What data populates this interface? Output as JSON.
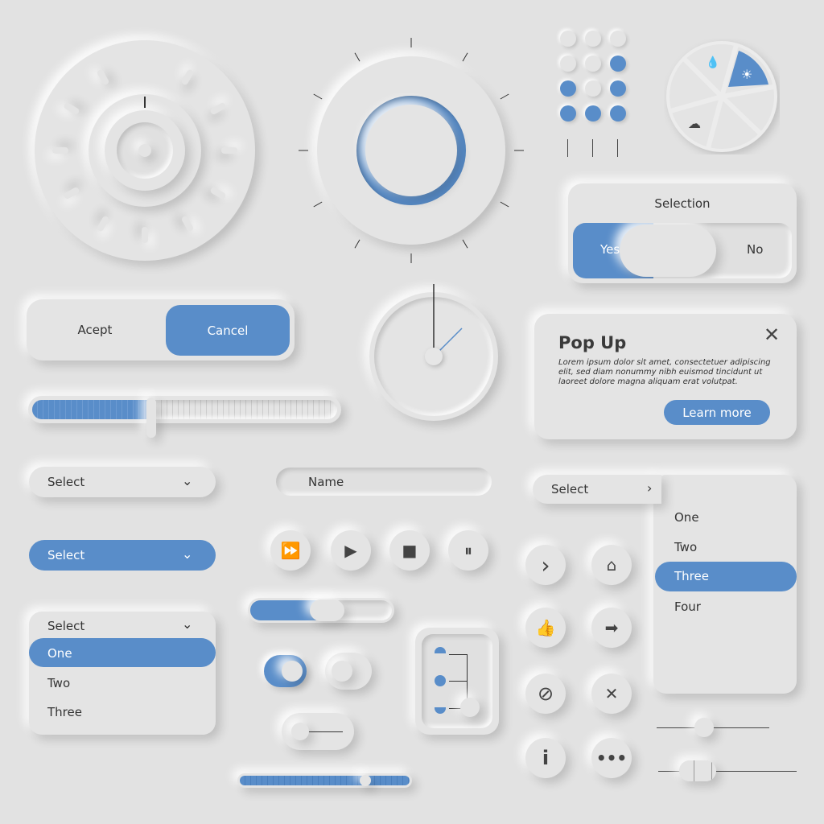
{
  "colors": {
    "background": "#e2e2e2",
    "accent": "#598dc9",
    "text": "#333333"
  },
  "buttons": {
    "accept": "Acept",
    "cancel": "Cancel"
  },
  "selection": {
    "title": "Selection",
    "yes": "Yes",
    "no": "No",
    "value": "Yes"
  },
  "popup": {
    "title": "Pop Up",
    "body": "Lorem ipsum dolor sit amet, consectetuer adipiscing elit, sed diam nonummy nibh euismod tincidunt ut laoreet dolore magna aliquam erat volutpat.",
    "learn_more": "Learn more",
    "close_icon": "close-icon"
  },
  "selects": {
    "plain": "Select",
    "blue": "Select",
    "open": {
      "label": "Select",
      "options": [
        "One",
        "Two",
        "Three"
      ],
      "selected": "One"
    },
    "side": {
      "label": "Select",
      "options": [
        "One",
        "Two",
        "Three",
        "Four"
      ],
      "selected": "Three"
    }
  },
  "name_input": {
    "placeholder": "Name"
  },
  "media": [
    "fast-forward-icon",
    "play-icon",
    "stop-icon",
    "pause-icon"
  ],
  "icon_buttons": [
    "chevron-right-icon",
    "home-icon",
    "thumbs-up-icon",
    "arrow-right-icon",
    "ban-icon",
    "close-icon",
    "info-icon",
    "more-icon"
  ],
  "weather_wheel": {
    "selected": "sun-icon",
    "icons": [
      "rain-icon",
      "sun-icon",
      "cloud-icon"
    ]
  },
  "dot_grid": [
    [
      false,
      false,
      false
    ],
    [
      false,
      false,
      true
    ],
    [
      true,
      false,
      true
    ],
    [
      true,
      true,
      true
    ]
  ],
  "sliders": {
    "main_progress": 0.39,
    "small_progress": 0.42,
    "bottom": 0.7,
    "right_1": 0.42,
    "right_2": 0.15
  },
  "toggles": [
    true,
    false,
    false
  ]
}
